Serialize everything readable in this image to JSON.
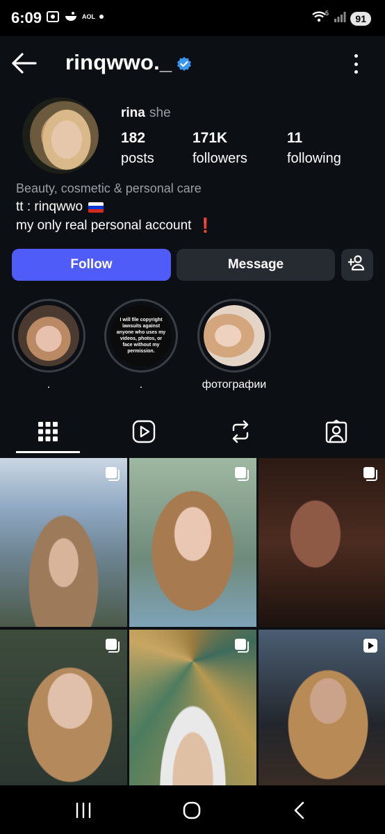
{
  "status_bar": {
    "time": "6:09",
    "aol_label": "AOL",
    "wifi_badge": "5",
    "battery": "91"
  },
  "header": {
    "username": "rinqwwo._",
    "verified": true,
    "back_icon": "arrow-left-icon",
    "more_icon": "more-vertical-icon"
  },
  "profile": {
    "display_name": "rina",
    "pronouns": "she",
    "stats": {
      "posts": {
        "value": "182",
        "label": "posts"
      },
      "followers": {
        "value": "171K",
        "label": "followers"
      },
      "following": {
        "value": "11",
        "label": "following"
      }
    },
    "category": "Beauty, cosmetic & personal care",
    "bio_line1": "tt : rinqwwo",
    "bio_line2": "my only real personal account",
    "bio_line2_emoji": "❗"
  },
  "actions": {
    "follow_label": "Follow",
    "message_label": "Message",
    "follow_color": "#4f5cf7"
  },
  "highlights": [
    {
      "caption": "."
    },
    {
      "caption": ".",
      "notice_text": "I will file copyright lawsuits against anyone who uses my videos, photos, or face without my permission."
    },
    {
      "caption": "фотографии"
    }
  ],
  "tabs": [
    {
      "icon": "grid-icon",
      "active": true
    },
    {
      "icon": "reels-icon",
      "active": false
    },
    {
      "icon": "reposts-icon",
      "active": false
    },
    {
      "icon": "tagged-icon",
      "active": false
    }
  ],
  "posts": [
    {
      "badge": "carousel-icon"
    },
    {
      "badge": "carousel-icon"
    },
    {
      "badge": "carousel-icon"
    },
    {
      "badge": "carousel-icon"
    },
    {
      "badge": "carousel-icon"
    },
    {
      "badge": "reel-icon"
    }
  ],
  "nav": [
    "recents-icon",
    "home-icon",
    "back-icon"
  ]
}
